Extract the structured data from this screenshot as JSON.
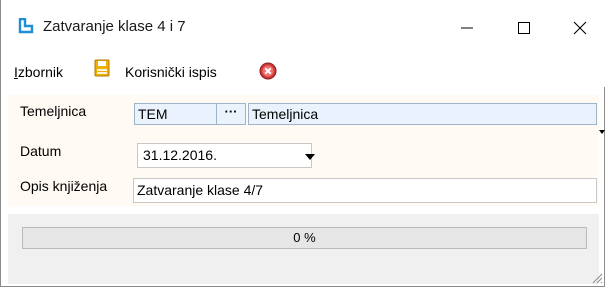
{
  "window": {
    "title": "Zatvaranje klase 4 i 7",
    "icon": "app-window-icon",
    "controls": {
      "minimize": "minimize-icon",
      "maximize": "maximize-icon",
      "close": "close-icon"
    }
  },
  "menubar": {
    "izbornik": "Izbornik",
    "izbornik_mnemonic": "I",
    "save_icon": "save-icon",
    "korisnicki_ispis": "Korisnički ispis",
    "cancel_icon": "cancel-icon"
  },
  "form": {
    "temeljnica_label": "Temeljnica",
    "temeljnica_code": "TEM",
    "lookup_button": "···",
    "temeljnica_name": "Temeljnica",
    "datum_label": "Datum",
    "datum_value": "31.12.2016.",
    "opis_label": "Opis knjiženja",
    "opis_value": "Zatvaranje klase 4/7"
  },
  "progress": {
    "text": "0 %",
    "value_percent": 0
  },
  "colors": {
    "field_bg": "#eaf3fd",
    "panel_bg": "#fffaf3",
    "app_icon": "#1e8fd6",
    "save_icon": "#f0b000",
    "cancel_icon": "#d23a3a"
  }
}
